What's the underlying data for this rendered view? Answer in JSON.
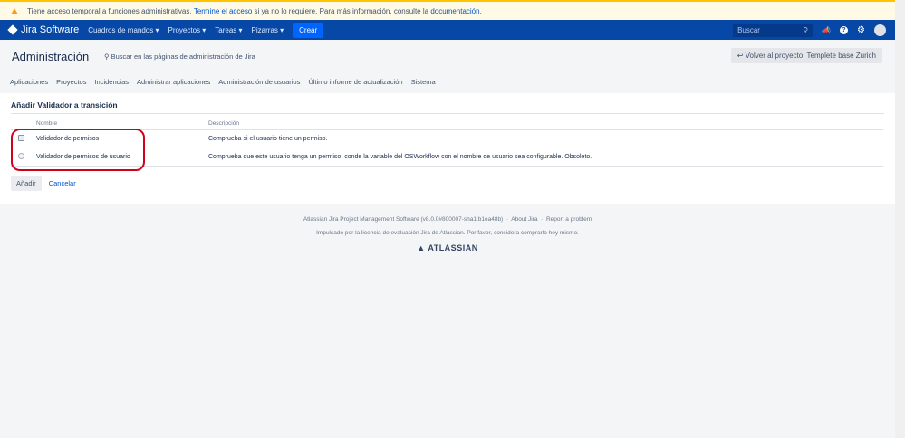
{
  "banner": {
    "text": "Tiene acceso temporal a funciones administrativas.",
    "link1": "Termine el acceso",
    "middle": "si ya no lo requiere. Para más información, consulte la",
    "link2": "documentación",
    "end": "."
  },
  "nav": {
    "logo": "Jira Software",
    "items": [
      "Cuadros de mandos ▾",
      "Proyectos ▾",
      "Tareas ▾",
      "Pizarras ▾"
    ],
    "create": "Crear",
    "search_placeholder": "Buscar"
  },
  "admin": {
    "title": "Administración",
    "search": "Buscar en las páginas de administración de Jira",
    "back": "Volver al proyecto: Templete base Zurich",
    "tabs": [
      "Aplicaciones",
      "Proyectos",
      "Incidencias",
      "Administrar aplicaciones",
      "Administración de usuarios",
      "Último informe de actualización",
      "Sistema"
    ]
  },
  "main": {
    "heading": "Añadir Validador a transición",
    "columns": [
      "Nombre",
      "Descripción"
    ],
    "rows": [
      {
        "name": "Validador de permisos",
        "desc": "Comprueba si el usuario tiene un permiso."
      },
      {
        "name": "Validador de permisos de usuario",
        "desc": "Comprueba que este usuario tenga un permiso, conde la variable del OSWorkflow con el nombre de usuario sea configurable. Obsoleto."
      }
    ],
    "add": "Añadir",
    "cancel": "Cancelar"
  },
  "footer": {
    "version": "Atlassian Jira Project Management Software (v8.0.0#800007-sha1:b1ea48b)",
    "about": "About Jira",
    "report": "Report a problem",
    "license": "Impulsado por la licencia de evaluación Jira de Atlassian. Por favor, considera comprarlo hoy mismo.",
    "brand": "ATLASSIAN"
  }
}
